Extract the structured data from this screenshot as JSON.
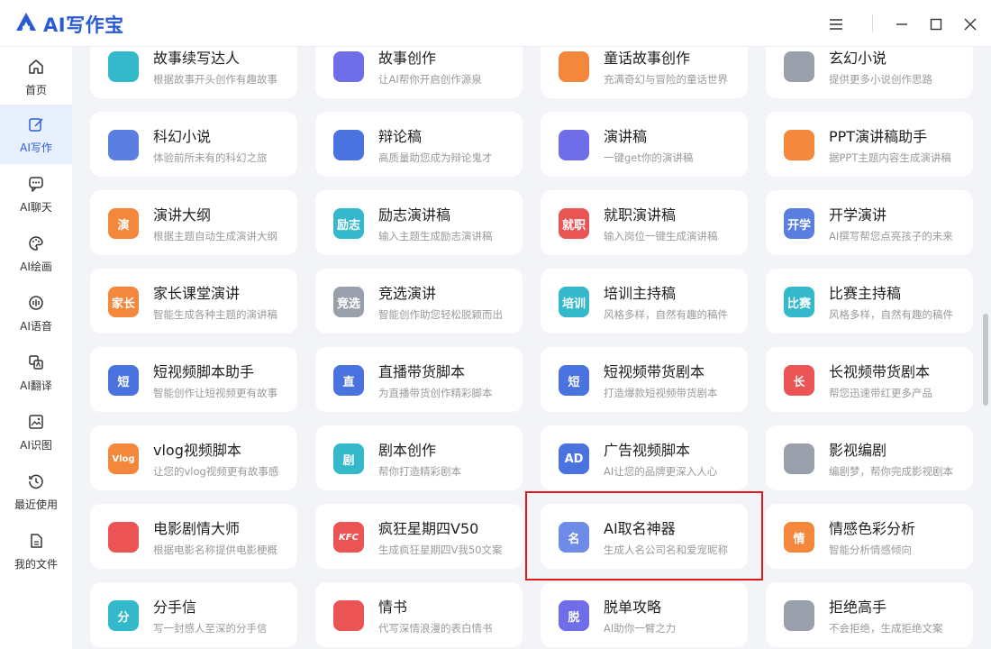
{
  "app": {
    "title": "AI写作宝"
  },
  "colors": {
    "brand": "#2a5bd7",
    "active_bg": "#e8f0fd",
    "highlight": "#e0191b"
  },
  "window_controls": [
    {
      "icon": "menu-icon"
    },
    {
      "icon": "minimize-icon"
    },
    {
      "icon": "maximize-icon"
    },
    {
      "icon": "close-icon"
    }
  ],
  "sidebar": {
    "items": [
      {
        "label": "首页",
        "icon": "home-icon"
      },
      {
        "label": "AI写作",
        "icon": "write-icon",
        "active": true
      },
      {
        "label": "AI聊天",
        "icon": "chat-icon"
      },
      {
        "label": "AI绘画",
        "icon": "palette-icon"
      },
      {
        "label": "AI语音",
        "icon": "voice-icon"
      },
      {
        "label": "AI翻译",
        "icon": "translate-icon"
      },
      {
        "label": "AI识图",
        "icon": "image-recognize-icon"
      },
      {
        "label": "最近使用",
        "icon": "history-icon"
      },
      {
        "label": "我的文件",
        "icon": "file-icon"
      }
    ]
  },
  "tools": [
    {
      "title": "故事续写达人",
      "desc": "根据故事开头创作有趣故事",
      "icon": "story-continue-icon",
      "color": "#33b9c9"
    },
    {
      "title": "故事创作",
      "desc": "让AI帮你开启创作源泉",
      "icon": "story-create-icon",
      "color": "#6f6ee8"
    },
    {
      "title": "童话故事创作",
      "desc": "充满奇幻与冒险的童话世界",
      "icon": "fairy-tale-icon",
      "color": "#f3873b"
    },
    {
      "title": "玄幻小说",
      "desc": "提供更多小说创作思路",
      "icon": "fantasy-novel-icon",
      "color": "#9aa0ab"
    },
    {
      "title": "科幻小说",
      "desc": "体验前所未有的科幻之旅",
      "icon": "scifi-novel-icon",
      "color": "#5b7fe0"
    },
    {
      "title": "辩论稿",
      "desc": "高质量助您成为辩论鬼才",
      "icon": "debate-icon",
      "color": "#4a73e0"
    },
    {
      "title": "演讲稿",
      "desc": "一键get你的演讲稿",
      "icon": "speech-icon",
      "color": "#6f6ee8"
    },
    {
      "title": "PPT演讲稿助手",
      "desc": "据PPT主题内容生成演讲稿",
      "icon": "ppt-speech-icon",
      "color": "#f3873b"
    },
    {
      "title": "演讲大纲",
      "desc": "根据主题自动生成演讲大纲",
      "icon": "speech-outline-icon",
      "color": "#f3873b",
      "glyph": "演"
    },
    {
      "title": "励志演讲稿",
      "desc": "输入主题生成励志演讲稿",
      "icon": "inspire-speech-icon",
      "color": "#33b9c9",
      "glyph": "励志"
    },
    {
      "title": "就职演讲稿",
      "desc": "输入岗位一键生成演讲稿",
      "icon": "inaugural-speech-icon",
      "color": "#ea5455",
      "glyph": "就职"
    },
    {
      "title": "开学演讲",
      "desc": "AI撰写帮您点亮孩子的未来",
      "icon": "school-speech-icon",
      "color": "#5b7fe0",
      "glyph": "开学"
    },
    {
      "title": "家长课堂演讲",
      "desc": "智能生成各种主题的演讲稿",
      "icon": "parent-speech-icon",
      "color": "#f3873b",
      "glyph": "家长"
    },
    {
      "title": "竞选演讲",
      "desc": "智能创作助您轻松脱颖而出",
      "icon": "campaign-speech-icon",
      "color": "#9aa0ab",
      "glyph": "竞选"
    },
    {
      "title": "培训主持稿",
      "desc": "风格多样，自然有趣的稿件",
      "icon": "training-host-icon",
      "color": "#33b9c9",
      "glyph": "培训"
    },
    {
      "title": "比赛主持稿",
      "desc": "风格多样，自然有趣的稿件",
      "icon": "contest-host-icon",
      "color": "#33b9c9",
      "glyph": "比赛"
    },
    {
      "title": "短视频脚本助手",
      "desc": "智能创作让短视频更有故事",
      "icon": "short-video-script-icon",
      "color": "#4a73e0",
      "glyph": "短"
    },
    {
      "title": "直播带货脚本",
      "desc": "为直播带货创作精彩脚本",
      "icon": "live-sales-script-icon",
      "color": "#4a73e0",
      "glyph": "直"
    },
    {
      "title": "短视频带货剧本",
      "desc": "打造爆款短视频带货剧本",
      "icon": "short-video-sales-icon",
      "color": "#4a73e0",
      "glyph": "短"
    },
    {
      "title": "长视频带货剧本",
      "desc": "帮您迅速带红更多产品",
      "icon": "long-video-sales-icon",
      "color": "#ea5455",
      "glyph": "长"
    },
    {
      "title": "vlog视频脚本",
      "desc": "让您的vlog视频更有故事感",
      "icon": "vlog-script-icon",
      "color": "#f3873b",
      "glyph": "Vlog"
    },
    {
      "title": "剧本创作",
      "desc": "帮你打造精彩剧本",
      "icon": "screenplay-icon",
      "color": "#33b9c9",
      "glyph": "剧"
    },
    {
      "title": "广告视频脚本",
      "desc": "AI让您的品牌更深入人心",
      "icon": "ad-video-script-icon",
      "color": "#4a73e0",
      "glyph": "AD"
    },
    {
      "title": "影视编剧",
      "desc": "编剧梦，帮你完成影视剧本",
      "icon": "film-screenwriter-icon",
      "color": "#9aa0ab"
    },
    {
      "title": "电影剧情大师",
      "desc": "根据电影名称提供电影梗概",
      "icon": "movie-plot-icon",
      "color": "#ea5455"
    },
    {
      "title": "疯狂星期四V50",
      "desc": "生成疯狂星期四V我50文案",
      "icon": "kfc-icon",
      "color": "#ea5455",
      "glyph": "KFC"
    },
    {
      "title": "AI取名神器",
      "desc": "生成人名公司名和爱宠昵称",
      "icon": "naming-icon",
      "color": "#6f8be8",
      "glyph": "名"
    },
    {
      "title": "情感色彩分析",
      "desc": "智能分析情感倾向",
      "icon": "emotion-analysis-icon",
      "color": "#f3873b",
      "glyph": "情"
    },
    {
      "title": "分手信",
      "desc": "写一封感人至深的分手信",
      "icon": "breakup-letter-icon",
      "color": "#33b9c9",
      "glyph": "分"
    },
    {
      "title": "情书",
      "desc": "代写深情浪漫的表白情书",
      "icon": "love-letter-icon",
      "color": "#ea5455"
    },
    {
      "title": "脱单攻略",
      "desc": "AI助你一臂之力",
      "icon": "dating-guide-icon",
      "color": "#6f6ee8",
      "glyph": "脱"
    },
    {
      "title": "拒绝高手",
      "desc": "不会拒绝，生成拒绝文案",
      "icon": "reject-master-icon",
      "color": "#9aa0ab"
    }
  ]
}
